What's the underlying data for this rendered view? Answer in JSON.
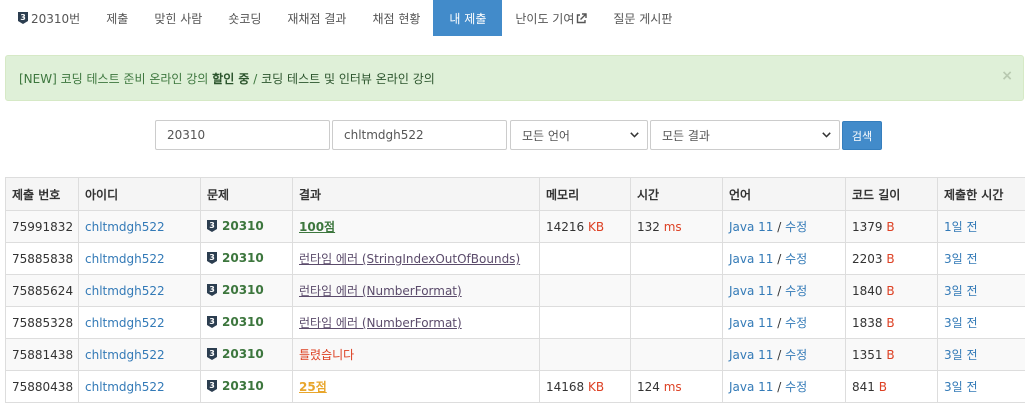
{
  "tabs": [
    {
      "label": "20310번",
      "has_tier": true,
      "active": false
    },
    {
      "label": "제출",
      "active": false
    },
    {
      "label": "맞힌 사람",
      "active": false
    },
    {
      "label": "숏코딩",
      "active": false
    },
    {
      "label": "재채점 결과",
      "active": false
    },
    {
      "label": "채점 현황",
      "active": false
    },
    {
      "label": "내 제출",
      "active": true
    },
    {
      "label": "난이도 기여",
      "external": true,
      "active": false
    },
    {
      "label": "질문 게시판",
      "active": false
    }
  ],
  "notice": {
    "prefix": "[NEW] 코딩 테스트 준비 온라인 강의 ",
    "bold": "할인 중",
    "middle": " / ",
    "link": "코딩 테스트 및 인터뷰 온라인 강의",
    "close": "×"
  },
  "filters": {
    "problem_id": "20310",
    "user_id": "chltmdgh522",
    "language": "모든 언어",
    "result": "모든 결과",
    "search_label": "검색"
  },
  "table": {
    "headers": [
      "제출 번호",
      "아이디",
      "문제",
      "결과",
      "메모리",
      "시간",
      "언어",
      "코드 길이",
      "제출한 시간"
    ],
    "rows": [
      {
        "id": "75991832",
        "user": "chltmdgh522",
        "problem": "20310",
        "result": "100점",
        "result_type": "ac",
        "memory": "14216",
        "memory_unit": "KB",
        "time": "132",
        "time_unit": "ms",
        "lang": "Java 11",
        "lang_sep": " / ",
        "edit": "수정",
        "code_len": "1379",
        "code_unit": "B",
        "submitted": "1일 전"
      },
      {
        "id": "75885838",
        "user": "chltmdgh522",
        "problem": "20310",
        "result": "런타임 에러 (StringIndexOutOfBounds)",
        "result_type": "rte",
        "memory": "",
        "memory_unit": "",
        "time": "",
        "time_unit": "",
        "lang": "Java 11",
        "lang_sep": " / ",
        "edit": "수정",
        "code_len": "2203",
        "code_unit": "B",
        "submitted": "3일 전"
      },
      {
        "id": "75885624",
        "user": "chltmdgh522",
        "problem": "20310",
        "result": "런타임 에러 (NumberFormat)",
        "result_type": "rte",
        "memory": "",
        "memory_unit": "",
        "time": "",
        "time_unit": "",
        "lang": "Java 11",
        "lang_sep": " / ",
        "edit": "수정",
        "code_len": "1840",
        "code_unit": "B",
        "submitted": "3일 전"
      },
      {
        "id": "75885328",
        "user": "chltmdgh522",
        "problem": "20310",
        "result": "런타임 에러 (NumberFormat)",
        "result_type": "rte",
        "memory": "",
        "memory_unit": "",
        "time": "",
        "time_unit": "",
        "lang": "Java 11",
        "lang_sep": " / ",
        "edit": "수정",
        "code_len": "1838",
        "code_unit": "B",
        "submitted": "3일 전"
      },
      {
        "id": "75881438",
        "user": "chltmdgh522",
        "problem": "20310",
        "result": "틀렸습니다",
        "result_type": "wa",
        "memory": "",
        "memory_unit": "",
        "time": "",
        "time_unit": "",
        "lang": "Java 11",
        "lang_sep": " / ",
        "edit": "수정",
        "code_len": "1351",
        "code_unit": "B",
        "submitted": "3일 전"
      },
      {
        "id": "75880438",
        "user": "chltmdgh522",
        "problem": "20310",
        "result": "25점",
        "result_type": "partial",
        "memory": "14168",
        "memory_unit": "KB",
        "time": "124",
        "time_unit": "ms",
        "lang": "Java 11",
        "lang_sep": " / ",
        "edit": "수정",
        "code_len": "841",
        "code_unit": "B",
        "submitted": "3일 전"
      }
    ]
  },
  "icons": {
    "tier": "tier-badge-icon",
    "external": "external-link-icon",
    "dropdown": "chevron-down-icon",
    "close": "close-icon"
  },
  "colors": {
    "primary": "#428bca",
    "tier_badge": "#2c3e50",
    "accepted": "#3c763d",
    "partial": "#e8a62c",
    "runtime_error": "#5b4b6b",
    "wrong": "#dd4124",
    "unit": "#dd4124",
    "link": "#337ab7"
  }
}
